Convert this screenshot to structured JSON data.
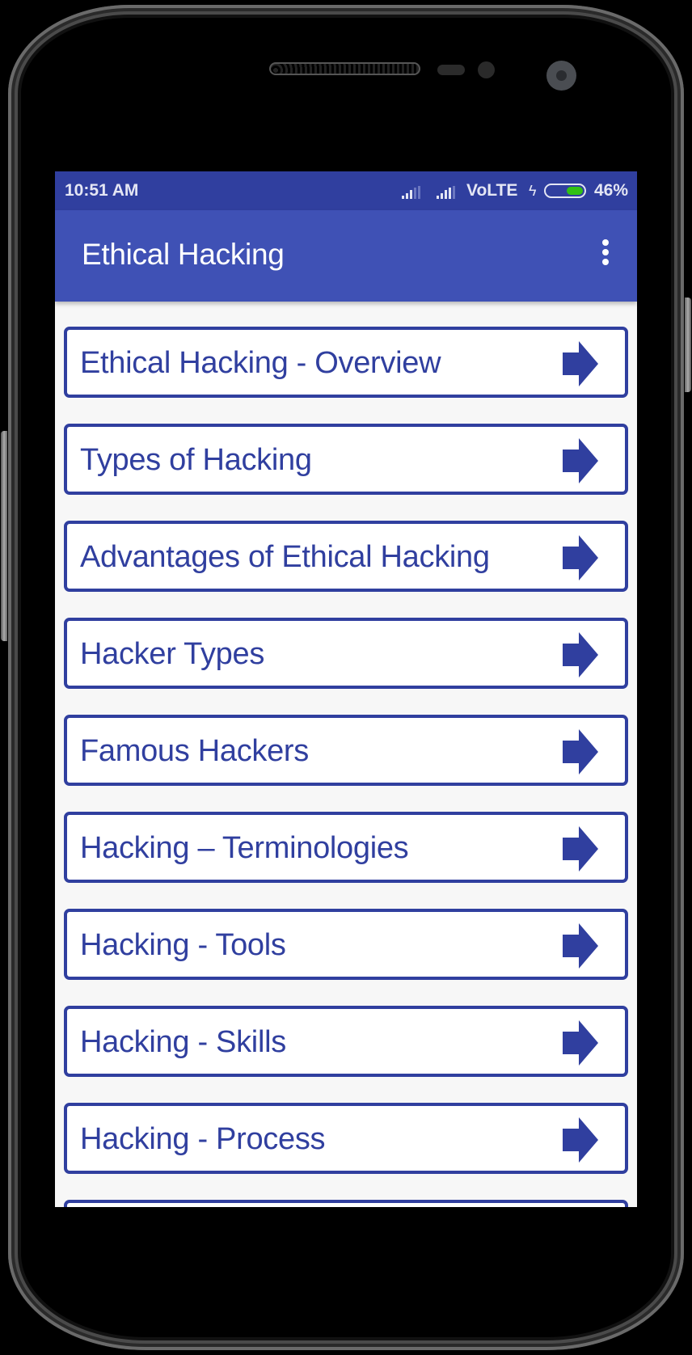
{
  "status_bar": {
    "time": "10:51 AM",
    "network": "VoLTE",
    "battery_percent_label": "46%",
    "battery_level": 0.46,
    "icons": [
      "signal-icon",
      "signal-icon",
      "charging-bolt-icon",
      "battery-icon"
    ]
  },
  "app_bar": {
    "title": "Ethical Hacking",
    "menu_icon": "more-vert-icon"
  },
  "colors": {
    "primary": "#3f51b5",
    "primary_dark": "#303f9f",
    "battery_green": "#31c114",
    "background": "#f7f7f7"
  },
  "topics": [
    {
      "label": "Ethical Hacking - Overview",
      "icon": "arrow-right-icon"
    },
    {
      "label": "Types of Hacking",
      "icon": "arrow-right-icon"
    },
    {
      "label": "Advantages of Ethical Hacking",
      "icon": "arrow-right-icon"
    },
    {
      "label": "Hacker Types",
      "icon": "arrow-right-icon"
    },
    {
      "label": "Famous Hackers",
      "icon": "arrow-right-icon"
    },
    {
      "label": "Hacking – Terminologies",
      "icon": "arrow-right-icon"
    },
    {
      "label": "Hacking - Tools",
      "icon": "arrow-right-icon"
    },
    {
      "label": "Hacking - Skills",
      "icon": "arrow-right-icon"
    },
    {
      "label": "Hacking - Process",
      "icon": "arrow-right-icon"
    },
    {
      "label": "",
      "icon": "arrow-right-icon"
    }
  ]
}
